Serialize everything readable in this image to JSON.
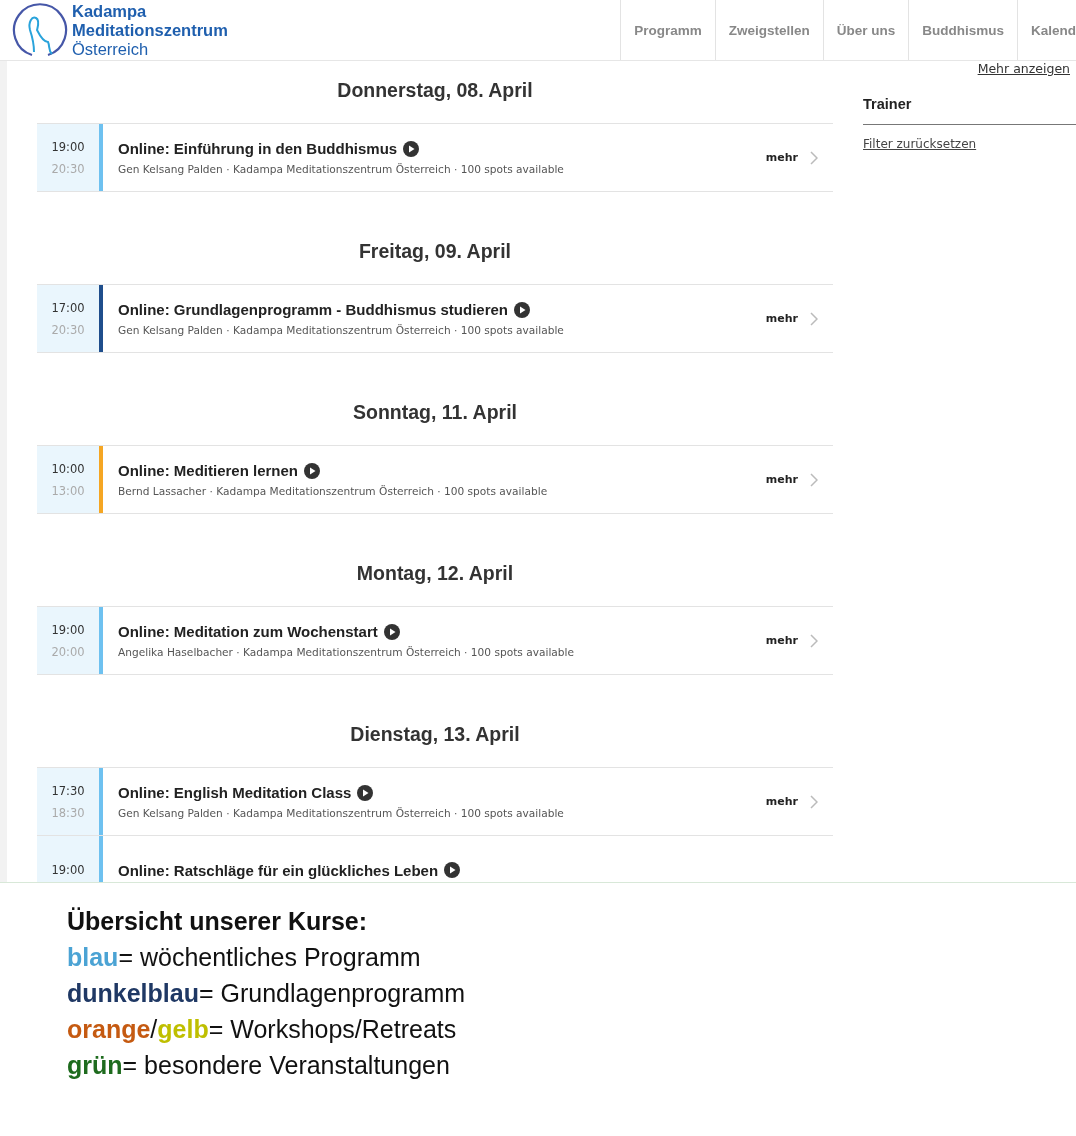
{
  "logo": {
    "lines": [
      "Kadampa",
      "Meditationszentrum",
      "Österreich"
    ]
  },
  "nav": [
    {
      "label": "Programm"
    },
    {
      "label": "Zweigstellen"
    },
    {
      "label": "Über uns"
    },
    {
      "label": "Buddhismus"
    },
    {
      "label": "Kalend"
    }
  ],
  "more_link": "Mehr anzeigen",
  "sidebar": {
    "heading": "Trainer",
    "reset_link": "Filter zurücksetzen"
  },
  "days": [
    {
      "heading": "Donnerstag, 08. April",
      "events": [
        {
          "start": "19:00",
          "end": "20:30",
          "title": "Online: Einführung in den Buddhismus",
          "details": "Gen Kelsang Palden · Kadampa Meditationszentrum Österreich · 100 spots available",
          "color": "#6ec1f0",
          "more": "mehr"
        }
      ]
    },
    {
      "heading": "Freitag, 09. April",
      "events": [
        {
          "start": "17:00",
          "end": "20:30",
          "title": "Online: Grundlagenprogramm - Buddhismus studieren",
          "details": "Gen Kelsang Palden · Kadampa Meditationszentrum Österreich · 100 spots available",
          "color": "#1f4e8c",
          "more": "mehr"
        }
      ]
    },
    {
      "heading": "Sonntag, 11. April",
      "events": [
        {
          "start": "10:00",
          "end": "13:00",
          "title": "Online: Meditieren lernen",
          "details": "Bernd Lassacher · Kadampa Meditationszentrum Österreich · 100 spots available",
          "color": "#f5a623",
          "more": "mehr"
        }
      ]
    },
    {
      "heading": "Montag, 12. April",
      "events": [
        {
          "start": "19:00",
          "end": "20:00",
          "title": "Online: Meditation zum Wochenstart",
          "details": "Angelika Haselbacher · Kadampa Meditationszentrum Österreich · 100 spots available",
          "color": "#6ec1f0",
          "more": "mehr"
        }
      ]
    },
    {
      "heading": "Dienstag, 13. April",
      "events": [
        {
          "start": "17:30",
          "end": "18:30",
          "title": "Online: English Meditation Class",
          "details": "Gen Kelsang Palden · Kadampa Meditationszentrum Österreich · 100 spots available",
          "color": "#6ec1f0",
          "more": "mehr"
        },
        {
          "start": "19:00",
          "title": "Online: Ratschläge für ein glückliches Leben",
          "color": "#6ec1f0"
        }
      ]
    }
  ],
  "legend": {
    "title": "Übersicht unserer Kurse:",
    "entries": [
      {
        "parts": [
          {
            "text": "blau",
            "color": "#4ba3d4"
          },
          {
            "text": "= wöchentliches Programm"
          }
        ]
      },
      {
        "parts": [
          {
            "text": "dunkelblau",
            "color": "#1f3864"
          },
          {
            "text": "= Grundlagenprogramm"
          }
        ]
      },
      {
        "parts": [
          {
            "text": "orange",
            "color": "#c55a11"
          },
          {
            "text": "/"
          },
          {
            "text": "gelb",
            "color": "#bfbf00"
          },
          {
            "text": "= Workshops/Retreats"
          }
        ]
      },
      {
        "parts": [
          {
            "text": "grün",
            "color": "#1e6b1e"
          },
          {
            "text": "= besondere Veranstaltungen"
          }
        ]
      }
    ]
  }
}
